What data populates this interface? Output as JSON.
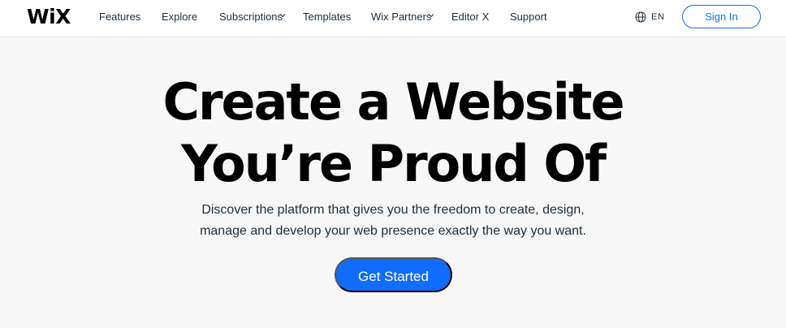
{
  "header": {
    "logo_text": "WiX",
    "nav": [
      {
        "label": "Features",
        "has_dropdown": false
      },
      {
        "label": "Explore",
        "has_dropdown": false
      },
      {
        "label": "Subscriptions",
        "has_dropdown": true
      },
      {
        "label": "Templates",
        "has_dropdown": false
      },
      {
        "label": "Wix Partners",
        "has_dropdown": true
      },
      {
        "label": "Editor X",
        "has_dropdown": false
      },
      {
        "label": "Support",
        "has_dropdown": false
      }
    ],
    "language": {
      "label": "EN",
      "icon": "globe-icon"
    },
    "sign_in_label": "Sign In"
  },
  "hero": {
    "title_line1": "Create a Website",
    "title_line2": "You’re Proud Of",
    "subtitle_line1": "Discover the platform that gives you the freedom to create, design,",
    "subtitle_line2": "manage and develop your web presence exactly the way you want.",
    "cta_label": "Get Started"
  },
  "colors": {
    "accent": "#116dff",
    "background": "#f7f7f7",
    "header_bg": "#ffffff",
    "text_dark": "#20303c"
  }
}
